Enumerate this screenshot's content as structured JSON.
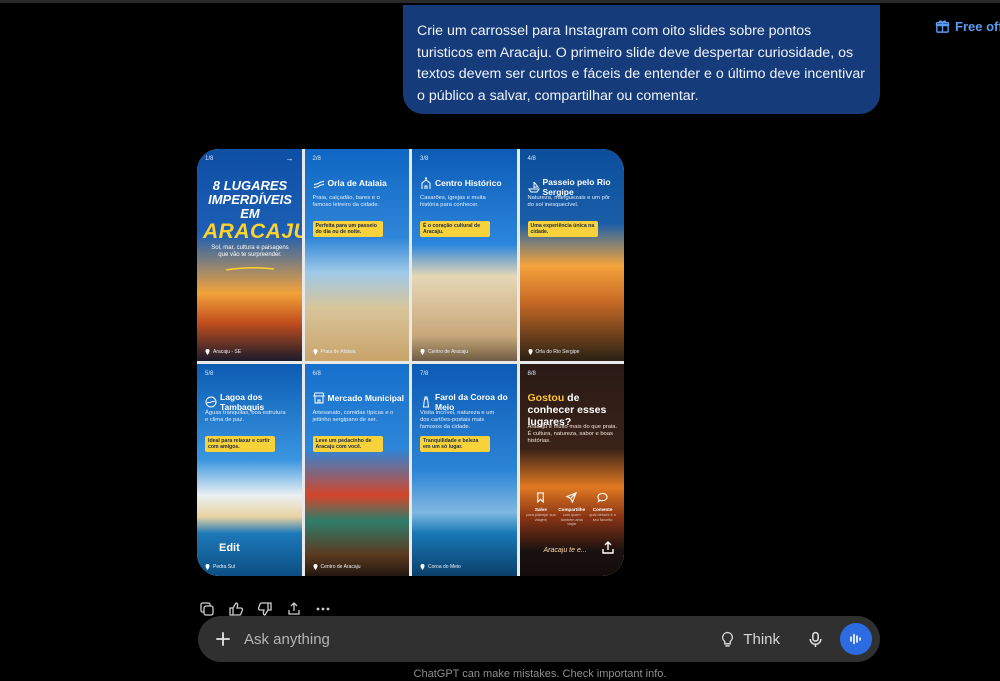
{
  "header": {
    "free_offer": "Free offer"
  },
  "user_message": "Crie um carrossel para Instagram com oito slides sobre pontos turisticos em Aracaju. O primeiro slide deve despertar curiosidade, os textos devem ser curtos e fáceis de entender e o último deve incentivar o público a salvar, compartilhar ou comentar.",
  "carousel": {
    "edit_label": "Edit",
    "slides": [
      {
        "num": "1/8",
        "title_line1": "8 LUGARES",
        "title_line2": "IMPERDÍVEIS EM",
        "title_big": "ARACAJU",
        "subtitle": "Sol, mar, cultura e paisagens que vão te surpreender.",
        "location": "Aracaju - SE"
      },
      {
        "num": "2/8",
        "title": "Orla de Atalaia",
        "desc": "Praia, calçadão, bares e o famoso letreiro da cidade.",
        "pill": "Perfeita para um passeio do dia ou de noite.",
        "location": "Praia de Atalaia"
      },
      {
        "num": "3/8",
        "title": "Centro Histórico",
        "desc": "Casarões, igrejas e muita história para conhecer.",
        "pill": "É o coração cultural de Aracaju.",
        "location": "Centro de Aracaju"
      },
      {
        "num": "4/8",
        "title": "Passeio pelo Rio Sergipe",
        "desc": "Natureza, manguezais e um pôr do sol inesquecível.",
        "pill": "Uma experiência única na cidade.",
        "location": "Orla do Rio Sergipe"
      },
      {
        "num": "5/8",
        "title": "Lagoa dos Tambaquis",
        "desc": "Águas tranquilas, boa estrutura e clima de paz.",
        "pill": "Ideal para relaxar e curtir com amigos.",
        "location": "Pedra Sul"
      },
      {
        "num": "6/8",
        "title": "Mercado Municipal",
        "desc": "Artesanato, comidas típicas e o jeitinho sergipano de ser.",
        "pill": "Leve um pedacinho de Aracaju com você.",
        "location": "Centro de Aracaju"
      },
      {
        "num": "7/8",
        "title": "Farol da Coroa do Meio",
        "desc": "Visita incrível, natureza e um dos cartões-postais mais famosos da cidade.",
        "pill": "Tranquilidade e beleza em um só lugar.",
        "location": "Coroa do Meio"
      },
      {
        "num": "8/8",
        "title_yellow": "Gostou",
        "title_rest": " de conhecer esses lugares?",
        "desc": "Aracaju é muito mais do que praia. É cultura, natureza, sabor e boas histórias.",
        "signature": "Aracaju te e...",
        "actions": [
          {
            "icon": "bookmark-icon",
            "label": "Salve",
            "sub": "para planejar sua viagem"
          },
          {
            "icon": "send-icon",
            "label": "Compartilhe",
            "sub": "com quem também ama viajar"
          },
          {
            "icon": "comment-icon",
            "label": "Comente",
            "sub": "qual desses é o seu favorito"
          }
        ]
      }
    ]
  },
  "composer": {
    "placeholder": "Ask anything",
    "think_label": "Think"
  },
  "disclaimer": "ChatGPT can make mistakes. Check important info.",
  "colors": {
    "accent_blue": "#2c6ce0",
    "bubble": "#153b7a",
    "highlight_yellow": "#f7d23a"
  }
}
